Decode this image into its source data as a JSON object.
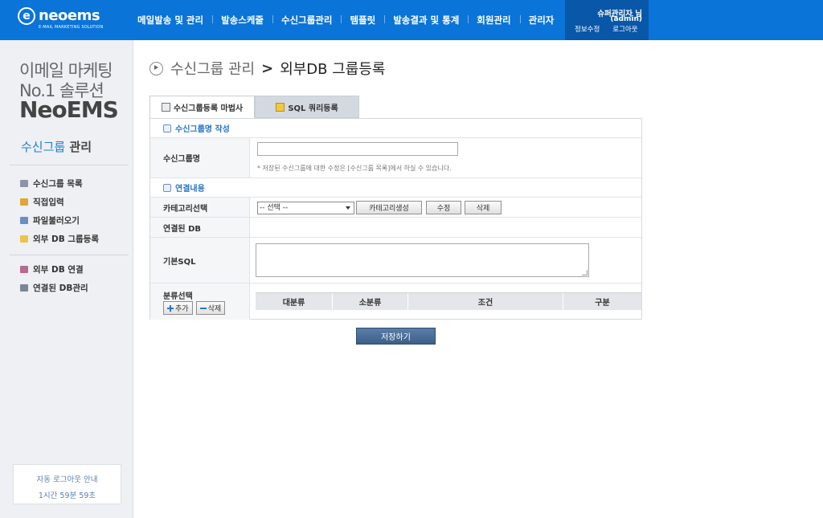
{
  "header": {
    "logo_text": "neoems",
    "logo_subtitle": "E-MAIL MARKETING SOLUTION",
    "nav": [
      "메일발송 및 관리",
      "발송스케줄",
      "수신그룹관리",
      "템플릿",
      "발송결과 및 통계",
      "회원관리",
      "관리자"
    ],
    "user_name": "슈퍼관리자 님",
    "user_id": "(admin)",
    "edit_info_label": "정보수정",
    "logout_label": "로그아웃"
  },
  "sidebar": {
    "tagline_1": "이메일 마케팅",
    "tagline_2": "No.1 솔루션",
    "brand": "NeoEMS",
    "section_blue": "수신그룹",
    "section_dark": " 관리",
    "menu_group_1": [
      {
        "label": "수신그룹 목록",
        "icon": "list-icon"
      },
      {
        "label": "직접입력",
        "icon": "pencil-icon"
      },
      {
        "label": "파일불러오기",
        "icon": "users-icon"
      },
      {
        "label": "외부 DB 그룹등록",
        "icon": "folder-icon"
      }
    ],
    "menu_group_2": [
      {
        "label": "외부 DB 연결",
        "icon": "database-icon"
      },
      {
        "label": "연결된 DB관리",
        "icon": "database-link-icon"
      }
    ],
    "autologout_title": "자동 로그아웃 안내",
    "autologout_time": "1시간 59분 59초"
  },
  "breadcrumb": {
    "parent": "수신그룹 관리",
    "separator": ">",
    "current": "외부DB 그룹등록"
  },
  "tabs": {
    "wizard": "수신그룹등록 마법사",
    "sql": "SQL 쿼리등록"
  },
  "form": {
    "section_name_title": "수신그룹명 작성",
    "group_name_label": "수신그룹명",
    "group_name_value": "",
    "group_name_hint": "* 저장된 수신그룹에 대한 수정은 [수신그룹 목록]에서 하실 수 있습니다.",
    "section_link_title": "연결내용",
    "category_label": "카테고리선택",
    "category_selected": "-- 선택 --",
    "category_create_button": "카테고리생성",
    "category_edit_button": "수정",
    "category_delete_button": "삭제",
    "linked_db_label": "연결된 DB",
    "linked_db_value": "",
    "base_sql_label": "기본SQL",
    "base_sql_value": "",
    "classification_label": "분류선택",
    "add_button": "추가",
    "delete_button": "삭제",
    "classification_columns": [
      "대분류",
      "소분류",
      "조건",
      "구분"
    ]
  },
  "save_button": "저장하기",
  "colors": {
    "topbar": "#0a74d8",
    "userbox": "#0857a8",
    "accent": "#2a74c8",
    "save": "#4a6d96"
  }
}
